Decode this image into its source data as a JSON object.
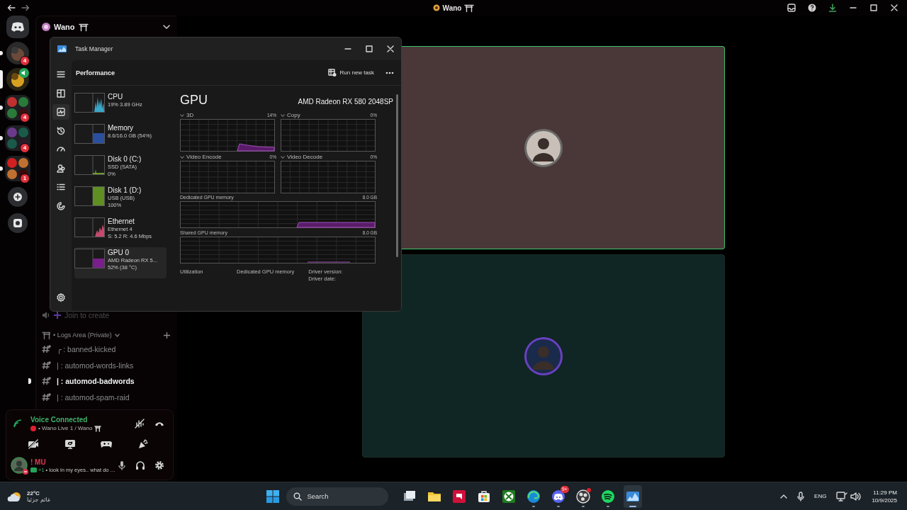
{
  "window": {
    "title": "Wano"
  },
  "server_rail": {
    "servers": [
      {
        "mentions": "4",
        "selected": false,
        "unread": true,
        "in_voice": false
      },
      {
        "selected": true,
        "unread": false,
        "in_voice": true
      },
      {
        "mentions": "4",
        "selected": false,
        "unread": true,
        "in_voice": false
      },
      {
        "mentions": "4",
        "selected": false,
        "unread": true,
        "in_voice": false
      },
      {
        "mentions": "1",
        "selected": false,
        "unread": true,
        "in_voice": false
      }
    ]
  },
  "channel_sidebar": {
    "server_name": "Wano",
    "join_to_create": "Join to create",
    "category": {
      "name": "• Logs Area (Private)",
      "expanded": true
    },
    "channels": [
      {
        "prefix": "╭ :",
        "name": "banned-kicked",
        "unread": false
      },
      {
        "prefix": "| :",
        "name": "automod-words-links",
        "unread": false
      },
      {
        "prefix": "| :",
        "name": "automod-badwords",
        "unread": true
      },
      {
        "prefix": "| :",
        "name": "automod-spam-raid",
        "unread": false
      }
    ]
  },
  "voice_panel": {
    "status": "Voice Connected",
    "location": "• Wano Live 1 / Wano"
  },
  "user_panel": {
    "name": "! MU",
    "extra": "+1",
    "status": "• look in my eyes.. what do …"
  },
  "video_tiles": [
    {
      "speaking": true,
      "color": "#4a3838"
    },
    {
      "speaking": false,
      "color": "#0f2624"
    }
  ],
  "task_manager": {
    "title": "Task Manager",
    "page": "Performance",
    "run_new_task": "Run new task",
    "nav": [
      {
        "kind": "menu",
        "selected": false
      },
      {
        "kind": "processes",
        "selected": false
      },
      {
        "kind": "performance",
        "selected": true
      },
      {
        "kind": "history",
        "selected": false
      },
      {
        "kind": "startup",
        "selected": false
      },
      {
        "kind": "users",
        "selected": false
      },
      {
        "kind": "details",
        "selected": false
      },
      {
        "kind": "services",
        "selected": false
      }
    ],
    "devices": [
      {
        "name": "CPU",
        "lines": [
          "19% 3.89 GHz"
        ],
        "color": "#3aa7c9",
        "selected": false
      },
      {
        "name": "Memory",
        "lines": [
          "8.6/16.0 GB (54%)"
        ],
        "color": "#2a4f9e",
        "selected": false
      },
      {
        "name": "Disk 0 (C:)",
        "lines": [
          "SSD (SATA)",
          "0%"
        ],
        "color": "#6e9a2c",
        "selected": false
      },
      {
        "name": "Disk 1 (D:)",
        "lines": [
          "USB (USB)",
          "100%"
        ],
        "color": "#5f8f22",
        "selected": false
      },
      {
        "name": "Ethernet",
        "lines": [
          "Ethernet 4",
          "S: 5.2  R: 4.6 Mbps"
        ],
        "color": "#c44a6e",
        "selected": false
      },
      {
        "name": "GPU 0",
        "lines": [
          "AMD Radeon RX 5...",
          "52% (38 °C)"
        ],
        "color": "#7a1e8c",
        "selected": true
      }
    ],
    "detail": {
      "title": "GPU",
      "model": "AMD Radeon RX 580 2048SP",
      "engines": [
        {
          "name": "3D",
          "value": "14%"
        },
        {
          "name": "Copy",
          "value": "0%"
        },
        {
          "name": "Video Encode",
          "value": "0%"
        },
        {
          "name": "Video Decode",
          "value": "0%"
        }
      ],
      "memory_graphs": [
        {
          "name": "Dedicated GPU memory",
          "max": "8.0 GB"
        },
        {
          "name": "Shared GPU memory",
          "max": "8.0 GB"
        }
      ],
      "stats": [
        "Utilization",
        "Dedicated GPU memory",
        "Driver version:",
        "Driver date:"
      ]
    }
  },
  "taskbar": {
    "weather": {
      "temperature": "22°C",
      "condition": "غائم جزئيا"
    },
    "search": {
      "placeholder": "Search"
    },
    "apps": [
      {
        "kind": "taskview",
        "running": false,
        "active": false,
        "alert": false
      },
      {
        "kind": "explorer",
        "running": false,
        "active": false,
        "alert": false
      },
      {
        "kind": "redtile",
        "running": false,
        "active": false,
        "alert": false
      },
      {
        "kind": "store",
        "running": false,
        "active": false,
        "alert": false
      },
      {
        "kind": "xsphere",
        "running": false,
        "active": false,
        "alert": false
      },
      {
        "kind": "swirl",
        "running": true,
        "active": false,
        "alert": false
      },
      {
        "kind": "chat",
        "running": true,
        "active": false,
        "badge": "9+",
        "alert": false
      },
      {
        "kind": "ring",
        "running": true,
        "active": false,
        "alert": true
      },
      {
        "kind": "waves",
        "running": true,
        "active": false,
        "alert": false
      },
      {
        "kind": "graph",
        "running": true,
        "active": true,
        "alert": false
      }
    ],
    "tray": {
      "language": "ENG",
      "time": "11:29 PM",
      "date": "10/9/2025"
    }
  }
}
